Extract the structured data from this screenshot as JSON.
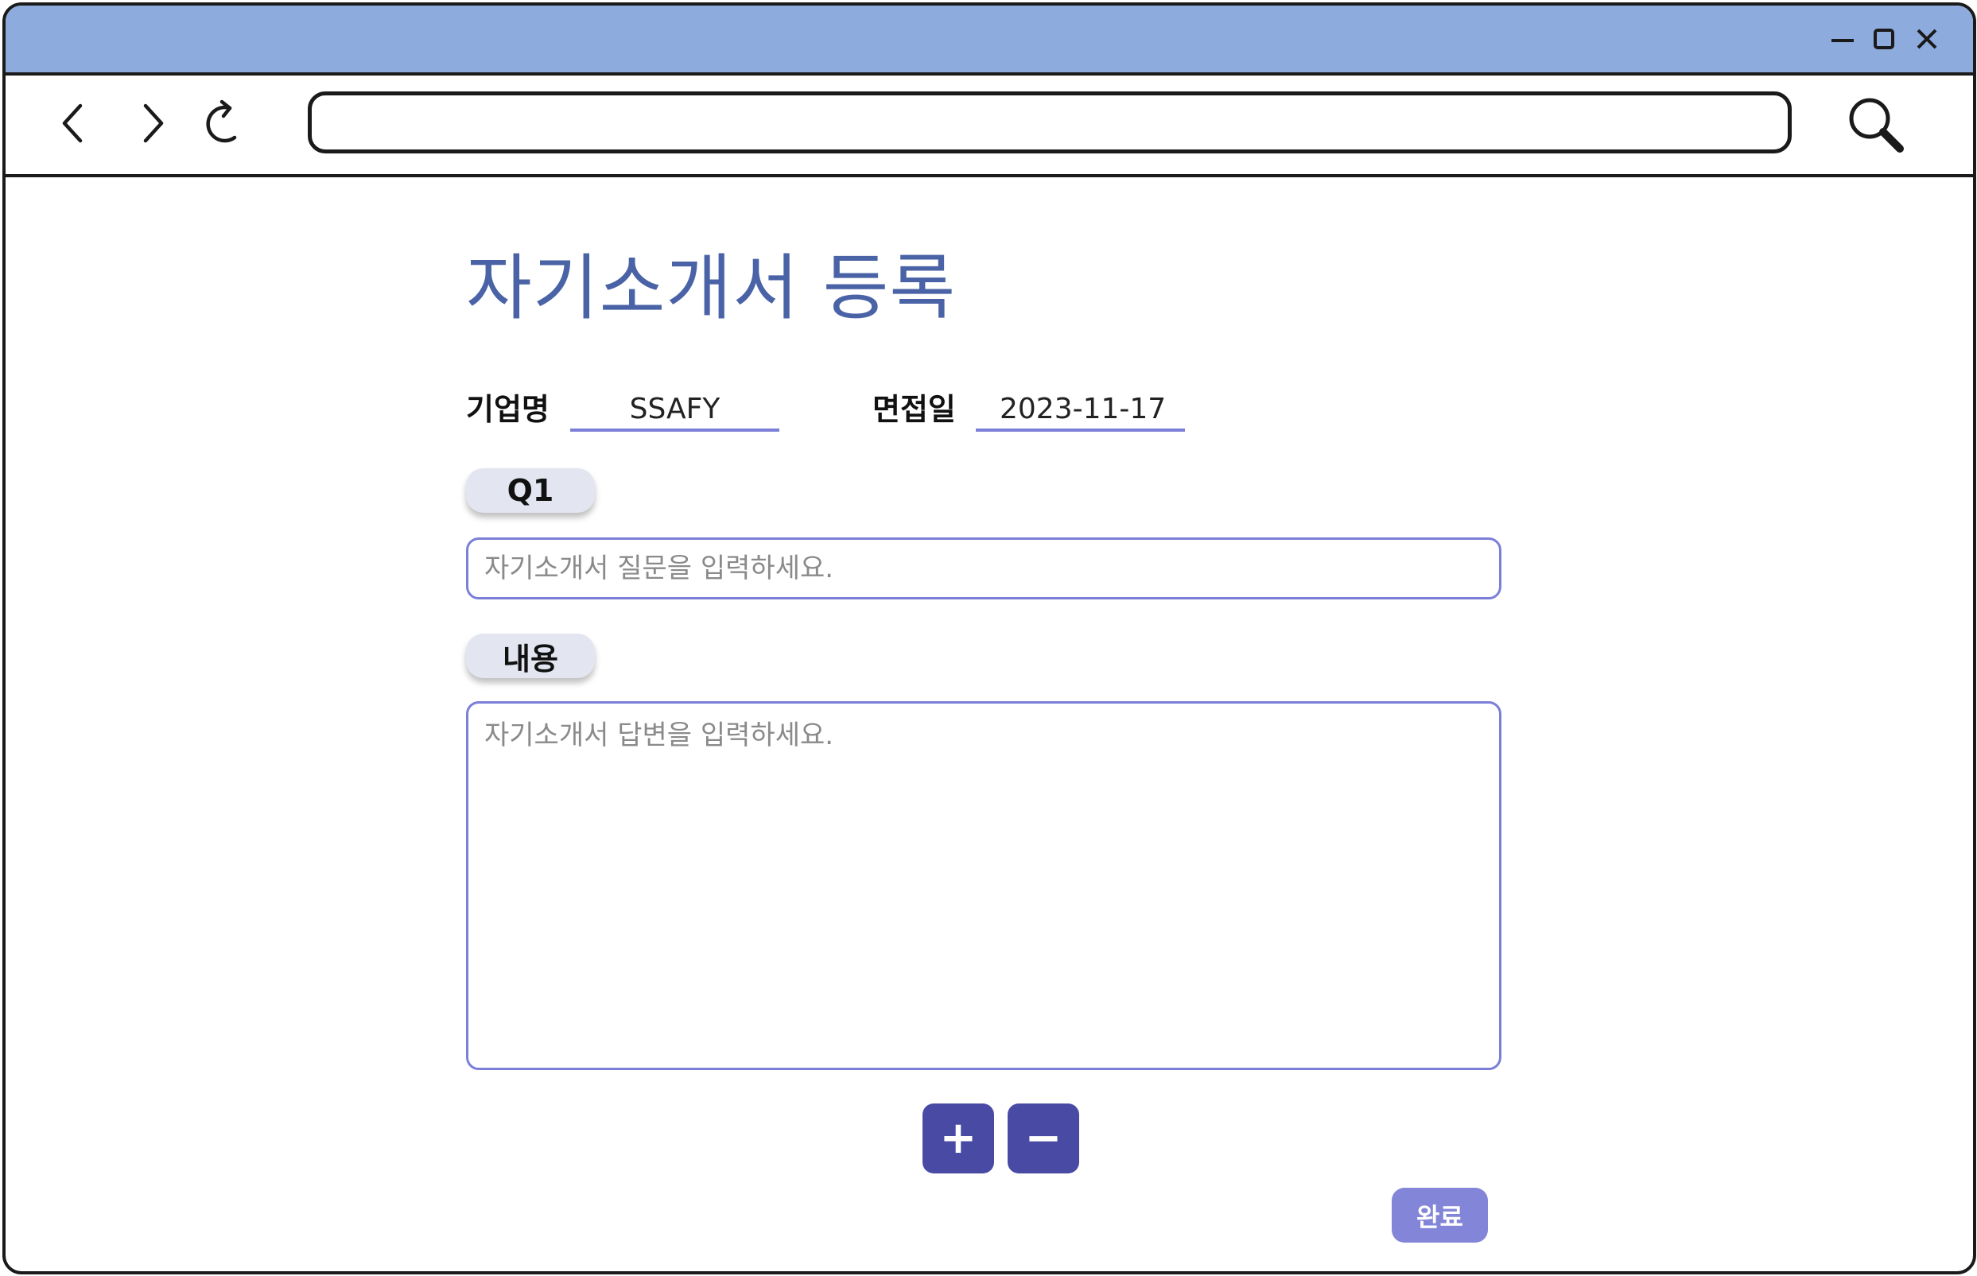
{
  "window": {
    "controls": [
      "minimize-icon",
      "maximize-icon",
      "close-icon"
    ],
    "title_bar_color": "#8eabde"
  },
  "browser": {
    "nav_icons": [
      "back-arrow-icon",
      "forward-arrow-icon",
      "refresh-icon",
      "search-icon"
    ],
    "address_value": ""
  },
  "page": {
    "title": "자기소개서 등록",
    "company_label": "기업명",
    "company_value": "SSAFY",
    "date_label": "면접일",
    "date_value": "2023-11-17",
    "question_tag": "Q1",
    "question_placeholder": "자기소개서 질문을 입력하세요.",
    "content_tag": "내용",
    "answer_placeholder": "자기소개서 답변을 입력하세요.",
    "add_label": "+",
    "remove_label": "−",
    "done_label": "완료"
  },
  "colors": {
    "title": "#4a63a6",
    "accent": "#7b7fd8",
    "button": "#484aa3",
    "done_button": "#8385d8"
  }
}
